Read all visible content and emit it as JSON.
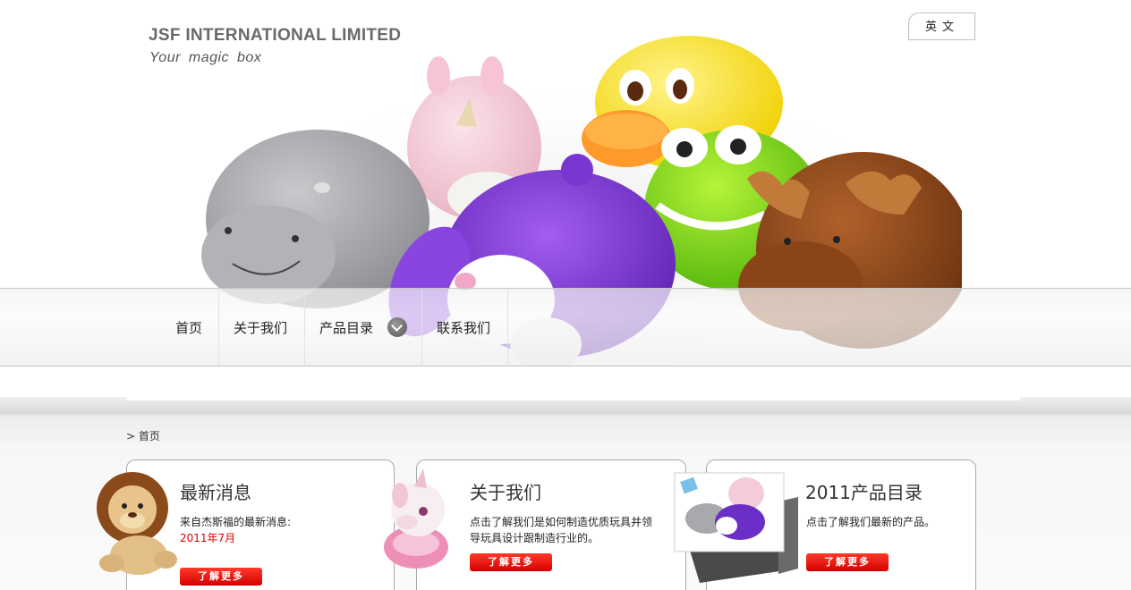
{
  "header": {
    "brand": "JSF INTERNATIONAL LIMITED",
    "tagline": "Your magic box",
    "lang_button": "英文"
  },
  "nav": {
    "items": [
      {
        "label": "首页"
      },
      {
        "label": "关于我们"
      },
      {
        "label": "产品目录"
      },
      {
        "label": "联系我们"
      }
    ]
  },
  "breadcrumb": "> 首页",
  "boxes": {
    "news": {
      "title": "最新消息",
      "text": "来自杰斯福的最新消息:",
      "highlight": "2011年7月",
      "button": "了解更多"
    },
    "about": {
      "title": "关于我们",
      "text_line1": "点击了解我们是如何制造优质玩具并领",
      "text_line2": "导玩具设计跟制造行业的。",
      "button": "了解更多"
    },
    "catalog": {
      "title": "2011产品目录",
      "text": "点击了解我们最新的产品。",
      "button": "了解更多"
    }
  },
  "colors": {
    "accent_red": "#e00000",
    "brand_gray": "#6a6a6a"
  }
}
